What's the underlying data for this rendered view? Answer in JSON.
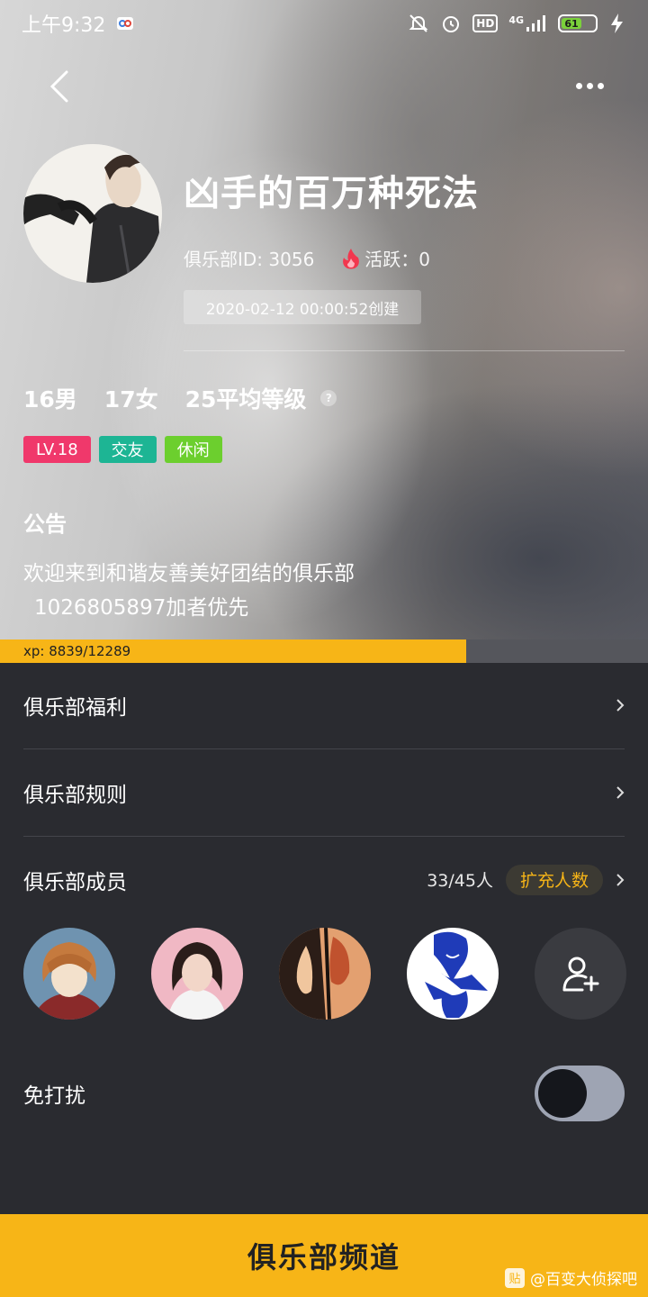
{
  "status_bar": {
    "time": "上午9:32",
    "network": "4G",
    "hd": "HD",
    "battery": "61",
    "icons": [
      "infinity-app-icon",
      "mute-icon",
      "alarm-icon",
      "hd-icon",
      "signal-icon",
      "battery-icon",
      "charging-icon"
    ]
  },
  "nav": {
    "back_icon": "chevron-left-icon",
    "more_icon": "more-dots-icon"
  },
  "club": {
    "name": "凶手的百万种死法",
    "id_label": "俱乐部ID: 3056",
    "activity_label": "活跃：0",
    "created": "2020-02-12 00:00:52创建"
  },
  "stats": {
    "male": "16男",
    "female": "17女",
    "avg_level": "25平均等级",
    "help": "?"
  },
  "tags": [
    {
      "label": "LV.18",
      "color": "#f0386b"
    },
    {
      "label": "交友",
      "color": "#1db594"
    },
    {
      "label": "休闲",
      "color": "#6ccf2e"
    }
  ],
  "notice": {
    "title": "公告",
    "line1": "欢迎来到和谐友善美好团结的俱乐部",
    "line2": "1026805897加者优先"
  },
  "xp": {
    "label": "xp: 8839/12289",
    "current": 8839,
    "max": 12289
  },
  "menu": {
    "welfare": "俱乐部福利",
    "rules": "俱乐部规则",
    "members": "俱乐部成员",
    "member_count": "33/45人",
    "expand": "扩充人数"
  },
  "dnd": {
    "label": "免打扰",
    "enabled": false
  },
  "bottom": {
    "channel": "俱乐部频道",
    "watermark": "@百变大侦探吧",
    "watermark_logo": "贴"
  },
  "colors": {
    "accent": "#f7b517",
    "background": "#2a2b30"
  }
}
